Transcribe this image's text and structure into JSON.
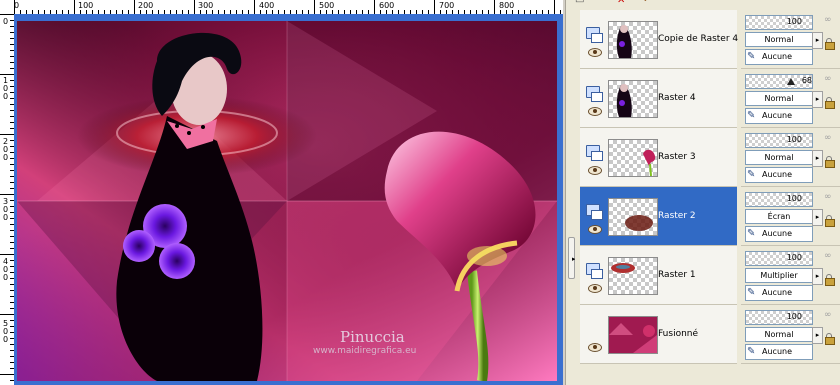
{
  "canvas": {
    "ruler_top_labels": [
      "0",
      "100",
      "200",
      "300",
      "400",
      "500",
      "600",
      "700",
      "800"
    ],
    "ruler_left_labels": [
      "0",
      "1\n0\n0",
      "2\n0\n0",
      "3\n0\n0",
      "4\n0\n0",
      "5\n0\n0"
    ],
    "watermark_name": "Pinuccia",
    "watermark_url": "www.maidiregrafica.eu"
  },
  "toolbar": {
    "icons": [
      "layer-properties-icon",
      "delete-layer-icon",
      "undo-icon"
    ]
  },
  "layers": [
    {
      "name": "Copie de Raster 4",
      "opacity": "100",
      "blend": "Normal",
      "mask": "Aucune",
      "selected": false
    },
    {
      "name": "Raster 4",
      "opacity": "68",
      "opacity_fraction": 0.68,
      "blend": "Normal",
      "mask": "Aucune",
      "selected": false
    },
    {
      "name": "Raster 3",
      "opacity": "100",
      "blend": "Normal",
      "mask": "Aucune",
      "selected": false
    },
    {
      "name": "Raster 2",
      "opacity": "100",
      "blend": "Écran",
      "mask": "Aucune",
      "selected": true
    },
    {
      "name": "Raster 1",
      "opacity": "100",
      "blend": "Multiplier",
      "mask": "Aucune",
      "selected": false
    },
    {
      "name": "Fusionné",
      "opacity": "100",
      "blend": "Normal",
      "mask": "Aucune",
      "selected": false
    }
  ],
  "colors": {
    "selection": "#316ac5",
    "canvas_border": "#3a6fd0"
  }
}
